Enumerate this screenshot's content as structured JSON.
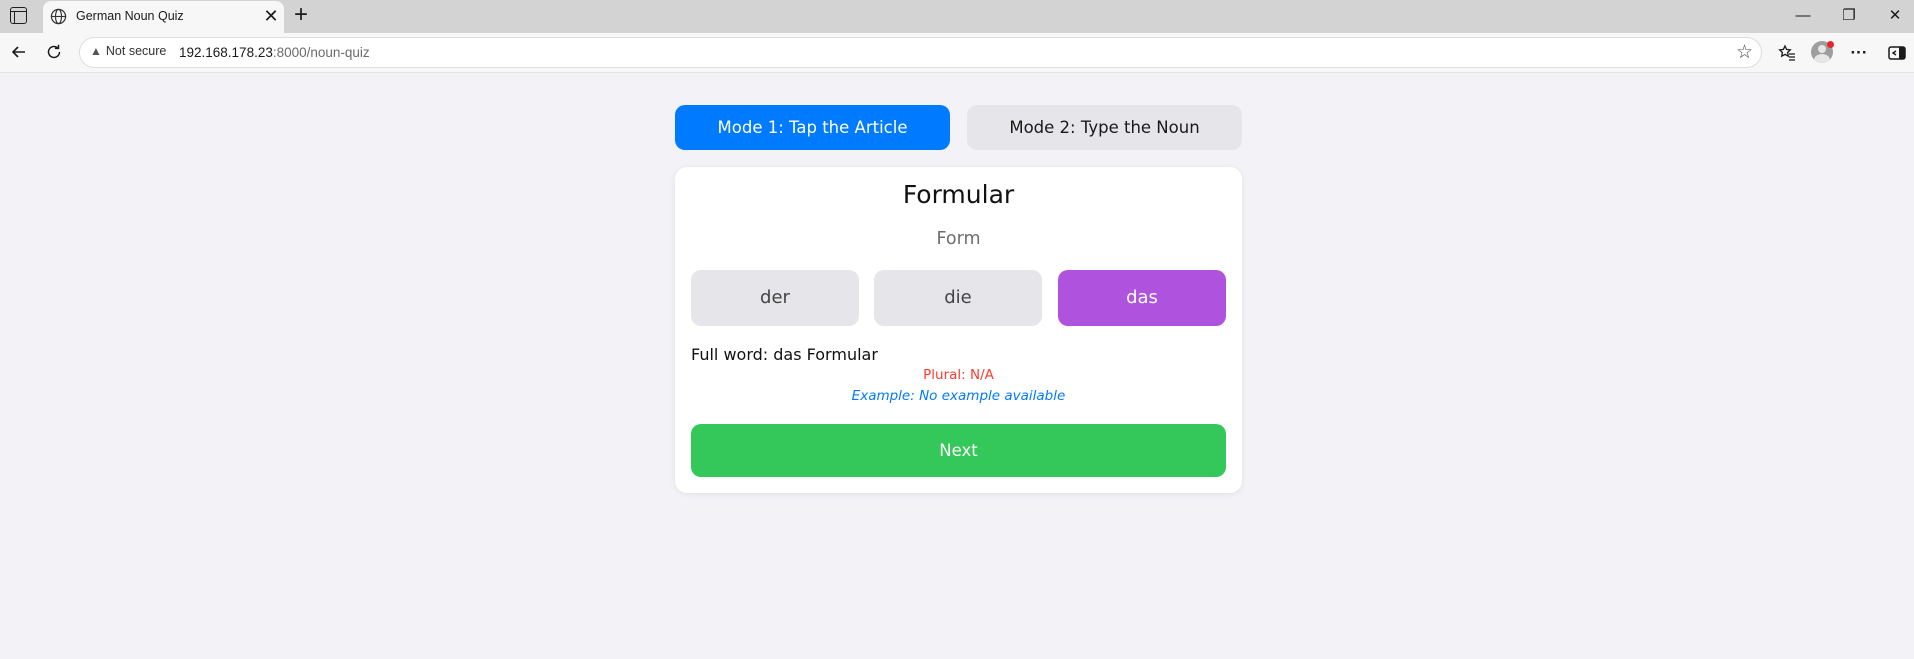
{
  "browser": {
    "tab_title": "German Noun Quiz",
    "tab_close_glyph": "✕",
    "new_tab_glyph": "+",
    "security_label": "Not secure",
    "url_host": "192.168.178.23",
    "url_rest": ":8000/noun-quiz",
    "window_controls": {
      "minimize": "—",
      "restore": "❐",
      "close": "✕"
    },
    "icons": [
      "tab-strip-icon",
      "globe-icon",
      "back-icon",
      "reload-icon",
      "warning-icon",
      "star-icon",
      "favorites-icon",
      "profile-avatar",
      "more-icon",
      "sidebar-icon"
    ]
  },
  "quiz": {
    "modes": [
      {
        "label": "Mode 1: Tap the Article",
        "active": true
      },
      {
        "label": "Mode 2: Type the Noun",
        "active": false
      }
    ],
    "word": "Formular",
    "translation": "Form",
    "articles": [
      {
        "label": "der",
        "selected": false
      },
      {
        "label": "die",
        "selected": false
      },
      {
        "label": "das",
        "selected": true
      }
    ],
    "full_word": "Full word: das Formular",
    "plural": "Plural: N/A",
    "example": "Example: No example available",
    "next_label": "Next"
  },
  "colors": {
    "mode_active": "#007aff",
    "mode_inactive": "#e5e5ea",
    "article_selected": "#af52de",
    "plural_text": "#ff3b30",
    "example_text": "#007aff",
    "next_button": "#34c759",
    "page_background": "#f2f2f7"
  }
}
